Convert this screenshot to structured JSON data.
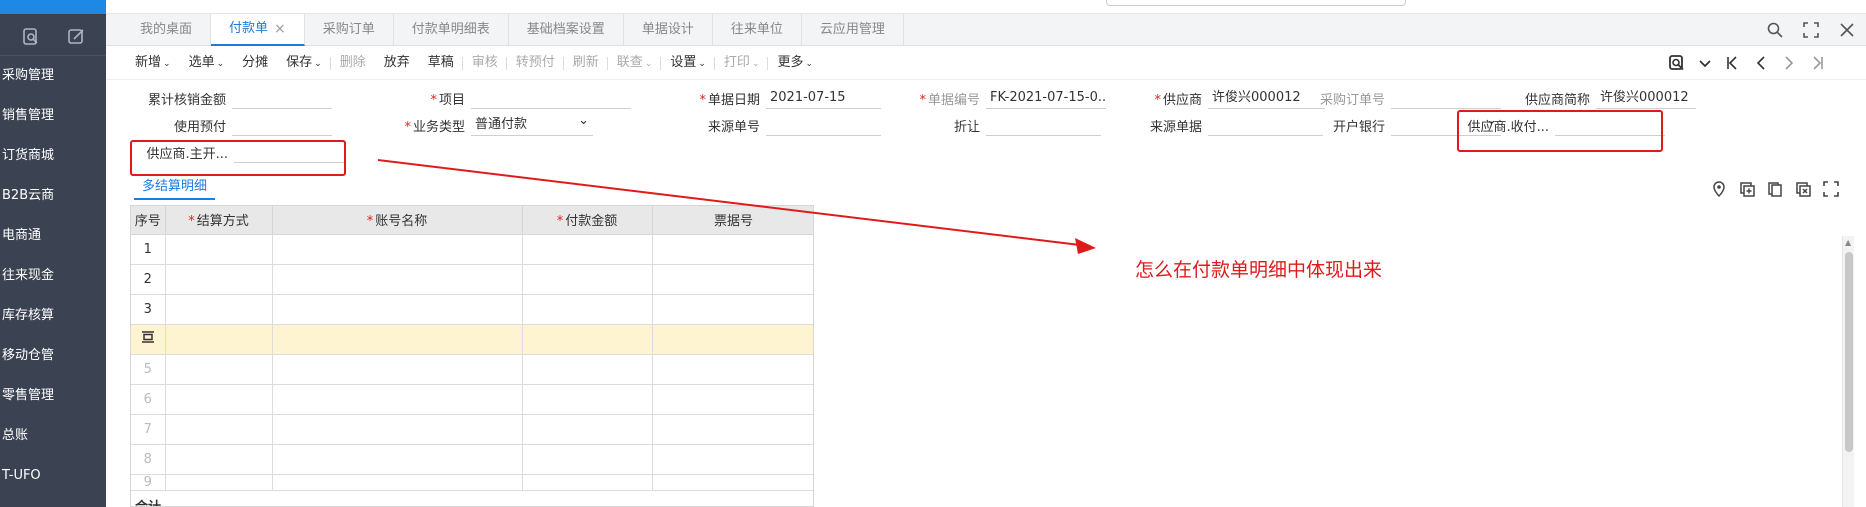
{
  "sidebar": {
    "items": [
      {
        "label": "采购管理"
      },
      {
        "label": "销售管理"
      },
      {
        "label": "订货商城"
      },
      {
        "label": "B2B云商"
      },
      {
        "label": "电商通"
      },
      {
        "label": "往来现金"
      },
      {
        "label": "库存核算"
      },
      {
        "label": "移动仓管"
      },
      {
        "label": "零售管理"
      },
      {
        "label": "总账"
      },
      {
        "label": "T-UFO"
      }
    ]
  },
  "tabs": [
    {
      "label": "我的桌面"
    },
    {
      "label": "付款单",
      "active": true,
      "close": "×"
    },
    {
      "label": "采购订单"
    },
    {
      "label": "付款单明细表"
    },
    {
      "label": "基础档案设置"
    },
    {
      "label": "单据设计"
    },
    {
      "label": "往来单位"
    },
    {
      "label": "云应用管理"
    }
  ],
  "toolbar": {
    "items": [
      {
        "label": "新增",
        "dropdown": true,
        "disabled": false
      },
      {
        "label": "选单",
        "dropdown": true,
        "disabled": false
      },
      {
        "label": "分摊",
        "dropdown": false,
        "disabled": false
      },
      {
        "label": "保存",
        "dropdown": true,
        "disabled": false
      },
      {
        "label": "删除",
        "dropdown": false,
        "disabled": true
      },
      {
        "label": "放弃",
        "dropdown": false,
        "disabled": false
      },
      {
        "label": "草稿",
        "dropdown": false,
        "disabled": false
      },
      {
        "label": "审核",
        "dropdown": false,
        "disabled": true
      },
      {
        "label": "转预付",
        "dropdown": false,
        "disabled": true
      },
      {
        "label": "刷新",
        "dropdown": false,
        "disabled": true
      },
      {
        "label": "联查",
        "dropdown": true,
        "disabled": true
      },
      {
        "label": "设置",
        "dropdown": true,
        "disabled": false
      },
      {
        "label": "打印",
        "dropdown": true,
        "disabled": true
      },
      {
        "label": "更多",
        "dropdown": true,
        "disabled": false
      }
    ],
    "caret": "⌄"
  },
  "form": {
    "fields": [
      {
        "label": "累计核销金额",
        "value": "",
        "required": false,
        "gray": false
      },
      {
        "label": "项目",
        "value": "",
        "required": true,
        "gray": false
      },
      {
        "label": "单据日期",
        "value": "2021-07-15",
        "required": true,
        "gray": false
      },
      {
        "label": "单据编号",
        "value": "FK-2021-07-15-0...",
        "required": true,
        "gray": true
      },
      {
        "label": "供应商",
        "value": "许俊兴000012",
        "required": true,
        "gray": false
      },
      {
        "label": "采购订单号",
        "value": "",
        "required": false,
        "gray": true
      },
      {
        "label": "供应商简称",
        "value": "许俊兴000012",
        "required": false,
        "gray": false
      },
      {
        "label": "使用预付",
        "value": "",
        "required": false,
        "gray": false
      },
      {
        "label": "业务类型",
        "value": "普通付款",
        "required": true,
        "gray": false
      },
      {
        "label": "来源单号",
        "value": "",
        "required": false,
        "gray": false
      },
      {
        "label": "折让",
        "value": "",
        "required": false,
        "gray": false
      },
      {
        "label": "来源单据",
        "value": "",
        "required": false,
        "gray": false
      },
      {
        "label": "开户银行",
        "value": "",
        "required": false,
        "gray": false
      },
      {
        "label": "供应商.收付...",
        "value": "",
        "required": false,
        "gray": false
      },
      {
        "label": "供应商.主开...",
        "value": "",
        "required": false,
        "gray": false
      }
    ],
    "required_mark": "*"
  },
  "subtab": {
    "label": "多结算明细"
  },
  "grid": {
    "columns": [
      {
        "label": "序号",
        "required": false
      },
      {
        "label": "结算方式",
        "required": true
      },
      {
        "label": "账号名称",
        "required": true
      },
      {
        "label": "付款金额",
        "required": true
      },
      {
        "label": "票据号",
        "required": false
      }
    ],
    "rows": [
      "1",
      "2",
      "3",
      "",
      "5",
      "6",
      "7",
      "8",
      "9"
    ],
    "total_label": "合计"
  },
  "annotation": {
    "text": "怎么在付款单明细中体现出来",
    "color": "#e01a1a"
  },
  "colors": {
    "accent": "#1e7be0",
    "sidebar": "#3b4352",
    "highlight_row": "#fff4d1",
    "annotation": "#e01a1a"
  }
}
